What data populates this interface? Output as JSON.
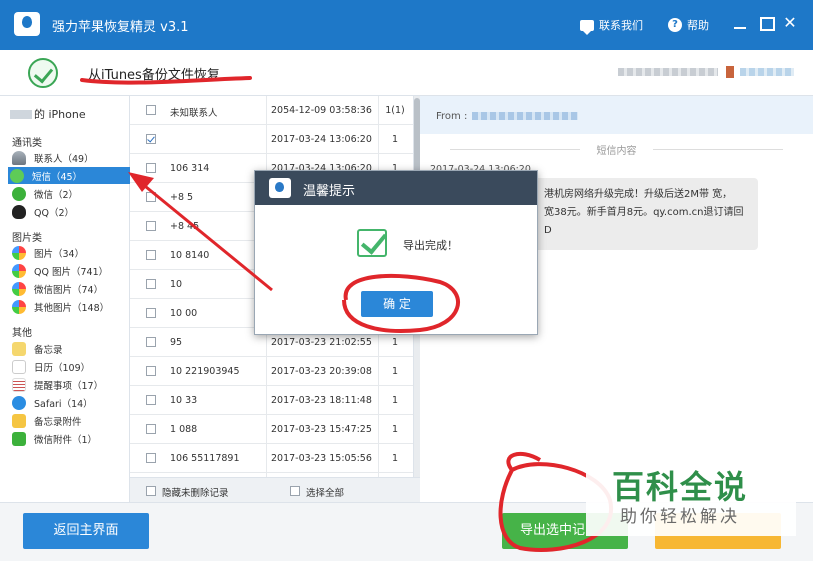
{
  "window": {
    "title": "强力苹果恢复精灵 v3.1",
    "contact_label": "联系我们",
    "help_label": "帮助",
    "minimize_symbol": "",
    "maximize_symbol": "",
    "close_symbol": "✕"
  },
  "subheader": {
    "title": "从iTunes备份文件恢复"
  },
  "sidebar": {
    "device_suffix": "的 iPhone",
    "categories": {
      "comm": "通讯类",
      "photo": "图片类",
      "other": "其他"
    },
    "items": [
      {
        "label": "联系人（49）",
        "icon": "contacts-icon"
      },
      {
        "label": "短信（45）",
        "icon": "sms-icon"
      },
      {
        "label": "微信（2）",
        "icon": "wechat-icon"
      },
      {
        "label": "QQ（2）",
        "icon": "qq-icon"
      },
      {
        "label": "图片（34）",
        "icon": "photos-icon"
      },
      {
        "label": "QQ 图片（741）",
        "icon": "qq-photos-icon"
      },
      {
        "label": "微信图片（74）",
        "icon": "wechat-photos-icon"
      },
      {
        "label": "其他图片（148）",
        "icon": "other-photos-icon"
      },
      {
        "label": "备忘录",
        "icon": "notes-icon"
      },
      {
        "label": "日历（109）",
        "icon": "calendar-icon"
      },
      {
        "label": "提醒事项（17）",
        "icon": "reminders-icon"
      },
      {
        "label": "Safari（14）",
        "icon": "safari-icon"
      },
      {
        "label": "备忘录附件",
        "icon": "notes-attachment-icon"
      },
      {
        "label": "微信附件（1）",
        "icon": "wechat-attachment-icon"
      }
    ]
  },
  "messages": [
    {
      "name": "未知联系人",
      "date": "2054-12-09 03:58:36",
      "count": "1(1)",
      "checked": false
    },
    {
      "name": "",
      "date": "2017-03-24 13:06:20",
      "count": "1",
      "checked": true
    },
    {
      "name": "106 314",
      "date": "2017-03-24 13:06:20",
      "count": "1",
      "checked": false
    },
    {
      "name": "+8 5",
      "date": "",
      "count": "",
      "checked": false
    },
    {
      "name": "+8 45",
      "date": "",
      "count": "",
      "checked": false
    },
    {
      "name": "10 8140",
      "date": "",
      "count": "",
      "checked": false
    },
    {
      "name": "10",
      "date": "",
      "count": "",
      "checked": false
    },
    {
      "name": "10 00",
      "date": "",
      "count": "",
      "checked": false
    },
    {
      "name": "95",
      "date": "2017-03-23 21:02:55",
      "count": "1",
      "checked": false
    },
    {
      "name": "10 221903945",
      "date": "2017-03-23 20:39:08",
      "count": "1",
      "checked": false
    },
    {
      "name": "10 33",
      "date": "2017-03-23 18:11:48",
      "count": "1",
      "checked": false
    },
    {
      "name": "1 088",
      "date": "2017-03-23 15:47:25",
      "count": "1",
      "checked": false
    },
    {
      "name": "106 55117891",
      "date": "2017-03-23 15:05:56",
      "count": "1",
      "checked": false
    }
  ],
  "list_footer": {
    "hide_deleted_label": "隐藏未删除记录",
    "select_all_label": "选择全部"
  },
  "detail": {
    "from_label": "From :",
    "content_heading": "短信内容",
    "message_date": "2017-03-24 13:06:20",
    "message_line1": "港机房网络升级完成！升级后送2M带 宽，",
    "message_line2": "宽38元。新手首月8元。qy.com.cn退订请回",
    "message_line3": "D"
  },
  "modal": {
    "title": "温馨提示",
    "message": "导出完成！",
    "ok_label": "确 定"
  },
  "bottom": {
    "back_label": "返回主界面",
    "export_label": "导出选中记"
  },
  "watermark": {
    "title": "百科全说",
    "subtitle": "助你轻松解决"
  },
  "colors": {
    "titlebar": "#1e78c8",
    "accent_blue": "#2b87d8",
    "export_green": "#46b348",
    "annotation_red": "#e0262b"
  }
}
